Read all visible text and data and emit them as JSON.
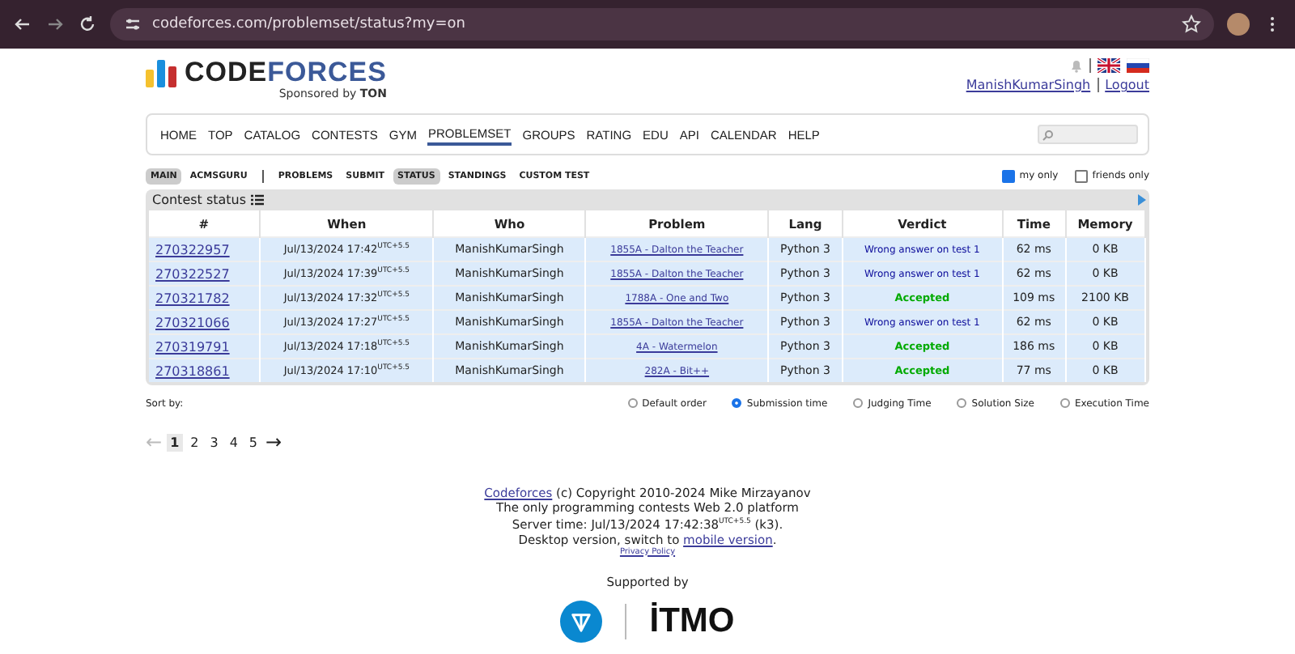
{
  "browser": {
    "url": "codeforces.com/problemset/status?my=on"
  },
  "header": {
    "logo": {
      "part_1": "CODE",
      "part_2": "FORCES"
    },
    "sponsor": "Sponsored by **TON**",
    "user": "ManishKumarSingh",
    "logout": "Logout"
  },
  "nav": [
    {
      "label": "HOME",
      "selected": false
    },
    {
      "label": "TOP",
      "selected": false
    },
    {
      "label": "CATALOG",
      "selected": false
    },
    {
      "label": "CONTESTS",
      "selected": false
    },
    {
      "label": "GYM",
      "selected": false
    },
    {
      "label": "PROBLEMSET",
      "selected": true
    },
    {
      "label": "GROUPS",
      "selected": false
    },
    {
      "label": "RATING",
      "selected": false
    },
    {
      "label": "EDU",
      "selected": false
    },
    {
      "label": "API",
      "selected": false
    },
    {
      "label": "CALENDAR",
      "selected": false
    },
    {
      "label": "HELP",
      "selected": false
    }
  ],
  "submenu_left": [
    {
      "label": "MAIN",
      "selected": true
    },
    {
      "label": "ACMSGURU",
      "selected": false
    }
  ],
  "submenu_right": [
    {
      "label": "PROBLEMS",
      "selected": false
    },
    {
      "label": "SUBMIT",
      "selected": false
    },
    {
      "label": "STATUS",
      "selected": true
    },
    {
      "label": "STANDINGS",
      "selected": false
    },
    {
      "label": "CUSTOM TEST",
      "selected": false
    }
  ],
  "filters": [
    {
      "label": "my only",
      "checked": true
    },
    {
      "label": "friends only",
      "checked": false
    }
  ],
  "table": {
    "title": "Contest status",
    "columns": [
      "#",
      "When",
      "Who",
      "Problem",
      "Lang",
      "Verdict",
      "Time",
      "Memory"
    ],
    "rows": [
      {
        "id": "270322957",
        "when": "Jul/13/2024 17:42$^{UTC+5.5}$",
        "who": "ManishKumarSingh",
        "problem": "1855A - Dalton the Teacher",
        "lang": "Python 3",
        "verdict": "Wrong answer on test 1",
        "kind": "wrong",
        "time": "62 ms",
        "memory": "0 KB"
      },
      {
        "id": "270322527",
        "when": "Jul/13/2024 17:39$^{UTC+5.5}$",
        "who": "ManishKumarSingh",
        "problem": "1855A - Dalton the Teacher",
        "lang": "Python 3",
        "verdict": "Wrong answer on test 1",
        "kind": "wrong",
        "time": "62 ms",
        "memory": "0 KB"
      },
      {
        "id": "270321782",
        "when": "Jul/13/2024 17:32$^{UTC+5.5}$",
        "who": "ManishKumarSingh",
        "problem": "1788A - One and Two",
        "lang": "Python 3",
        "verdict": "Accepted",
        "kind": "accepted",
        "time": "109 ms",
        "memory": "2100 KB"
      },
      {
        "id": "270321066",
        "when": "Jul/13/2024 17:27$^{UTC+5.5}$",
        "who": "ManishKumarSingh",
        "problem": "1855A - Dalton the Teacher",
        "lang": "Python 3",
        "verdict": "Wrong answer on test 1",
        "kind": "wrong",
        "time": "62 ms",
        "memory": "0 KB"
      },
      {
        "id": "270319791",
        "when": "Jul/13/2024 17:18$^{UTC+5.5}$",
        "who": "ManishKumarSingh",
        "problem": "4A - Watermelon",
        "lang": "Python 3",
        "verdict": "Accepted",
        "kind": "accepted",
        "time": "186 ms",
        "memory": "0 KB"
      },
      {
        "id": "270318861",
        "when": "Jul/13/2024 17:10$^{UTC+5.5}$",
        "who": "ManishKumarSingh",
        "problem": "282A - Bit++",
        "lang": "Python 3",
        "verdict": "Accepted",
        "kind": "accepted",
        "time": "77 ms",
        "memory": "0 KB"
      }
    ]
  },
  "sort": {
    "label": "Sort by:",
    "options": [
      {
        "label": "Default order",
        "selected": false
      },
      {
        "label": "Submission time",
        "selected": true
      },
      {
        "label": "Judging Time",
        "selected": false
      },
      {
        "label": "Solution Size",
        "selected": false
      },
      {
        "label": "Execution Time",
        "selected": false
      }
    ]
  },
  "pagination": {
    "prev": {
      "label": "←",
      "disabled": true
    },
    "pages": [
      {
        "label": "1",
        "selected": true
      },
      {
        "label": "2",
        "selected": false
      },
      {
        "label": "3",
        "selected": false
      },
      {
        "label": "4",
        "selected": false
      },
      {
        "label": "5",
        "selected": false
      }
    ],
    "next": {
      "label": "→",
      "disabled": false
    }
  },
  "footer": {
    "site_link": "Codeforces",
    "copyright": " (c) Copyright 2010-2024 Mike Mirzayanov",
    "tagline": "The only programming contests Web 2.0 platform",
    "server_time": "Server time: Jul/13/2024 17:42:38$^{UTC+5.5}$ (k3).",
    "desktop_prefix": "Desktop version, switch to ",
    "mobile_link": "mobile version",
    "desktop_suffix": ".",
    "privacy": "Privacy Policy",
    "supported_by": "Supported by",
    "partner": "İTMO"
  }
}
